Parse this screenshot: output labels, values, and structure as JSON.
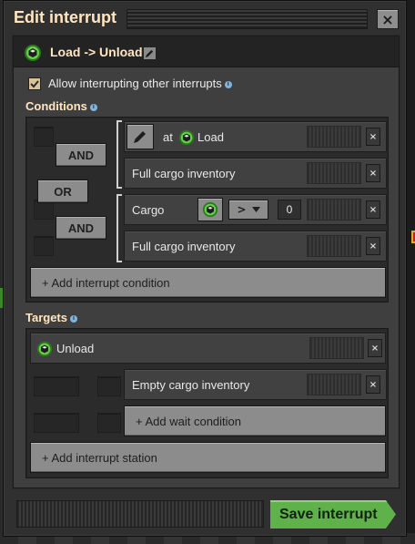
{
  "window": {
    "title": "Edit interrupt",
    "close_label": "×"
  },
  "interrupt": {
    "name": "Load -> Unload"
  },
  "options": {
    "allow_interrupting_label": "Allow interrupting other interrupts",
    "allow_interrupting_checked": true,
    "info_glyph": "i"
  },
  "conditions": {
    "label": "Conditions",
    "logic": {
      "and_1": "AND",
      "or": "OR",
      "and_2": "AND"
    },
    "rows": [
      {
        "prefix": "at",
        "station": "Load",
        "type": "at-station"
      },
      {
        "text": "Full cargo inventory"
      },
      {
        "text": "Cargo",
        "comparator": ">",
        "value": "0"
      },
      {
        "text": "Full cargo inventory"
      }
    ],
    "add_label": "+ Add interrupt condition",
    "remove_glyph": "×"
  },
  "targets": {
    "label": "Targets",
    "station": "Unload",
    "wait_rows": [
      {
        "text": "Empty cargo inventory"
      }
    ],
    "add_wait_label": "+ Add wait condition",
    "add_station_label": "+ Add interrupt station"
  },
  "footer": {
    "save_label": "Save interrupt"
  },
  "colors": {
    "accent_title": "#ffe6c0",
    "save_green": "#5fb24a",
    "panel_bg": "#403f40"
  }
}
